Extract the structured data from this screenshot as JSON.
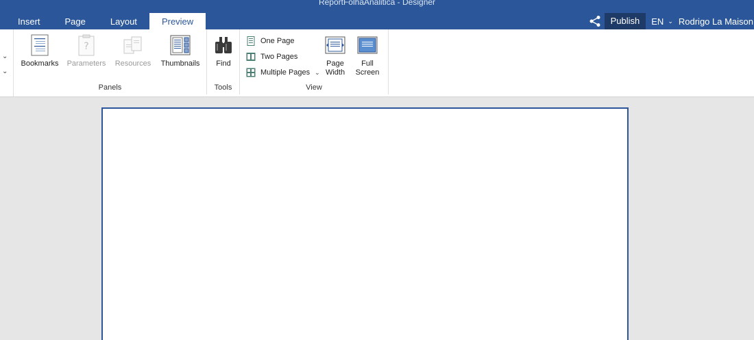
{
  "window": {
    "title": "ReportFolhaAnalitica - Designer"
  },
  "tabs": [
    {
      "label": "Insert",
      "active": false
    },
    {
      "label": "Page",
      "active": false
    },
    {
      "label": "Layout",
      "active": false
    },
    {
      "label": "Preview",
      "active": true
    }
  ],
  "header": {
    "share_icon": "share-icon",
    "publish_label": "Publish",
    "language": "EN",
    "user_name": "Rodrigo La Maison"
  },
  "ribbon": {
    "panels": {
      "label": "Panels",
      "buttons": [
        {
          "label": "Bookmarks",
          "icon": "bookmarks-icon",
          "enabled": true
        },
        {
          "label": "Parameters",
          "icon": "parameters-icon",
          "enabled": false
        },
        {
          "label": "Resources",
          "icon": "resources-icon",
          "enabled": false
        },
        {
          "label": "Thumbnails",
          "icon": "thumbnails-icon",
          "enabled": true
        }
      ]
    },
    "tools": {
      "label": "Tools",
      "buttons": [
        {
          "label": "Find",
          "icon": "binoculars-icon",
          "enabled": true
        }
      ]
    },
    "view": {
      "label": "View",
      "small_buttons": [
        {
          "label": "One Page",
          "icon": "one-page-icon"
        },
        {
          "label": "Two Pages",
          "icon": "two-pages-icon"
        },
        {
          "label": "Multiple Pages",
          "icon": "multiple-pages-icon"
        }
      ],
      "page_width": {
        "line1": "Page",
        "line2": "Width",
        "icon": "page-width-icon"
      },
      "full_screen": {
        "line1": "Full",
        "line2": "Screen",
        "icon": "full-screen-icon"
      }
    }
  },
  "colors": {
    "accent": "#2b579a",
    "publish_bg": "#1e3a66",
    "workspace_bg": "#e6e6e6"
  }
}
